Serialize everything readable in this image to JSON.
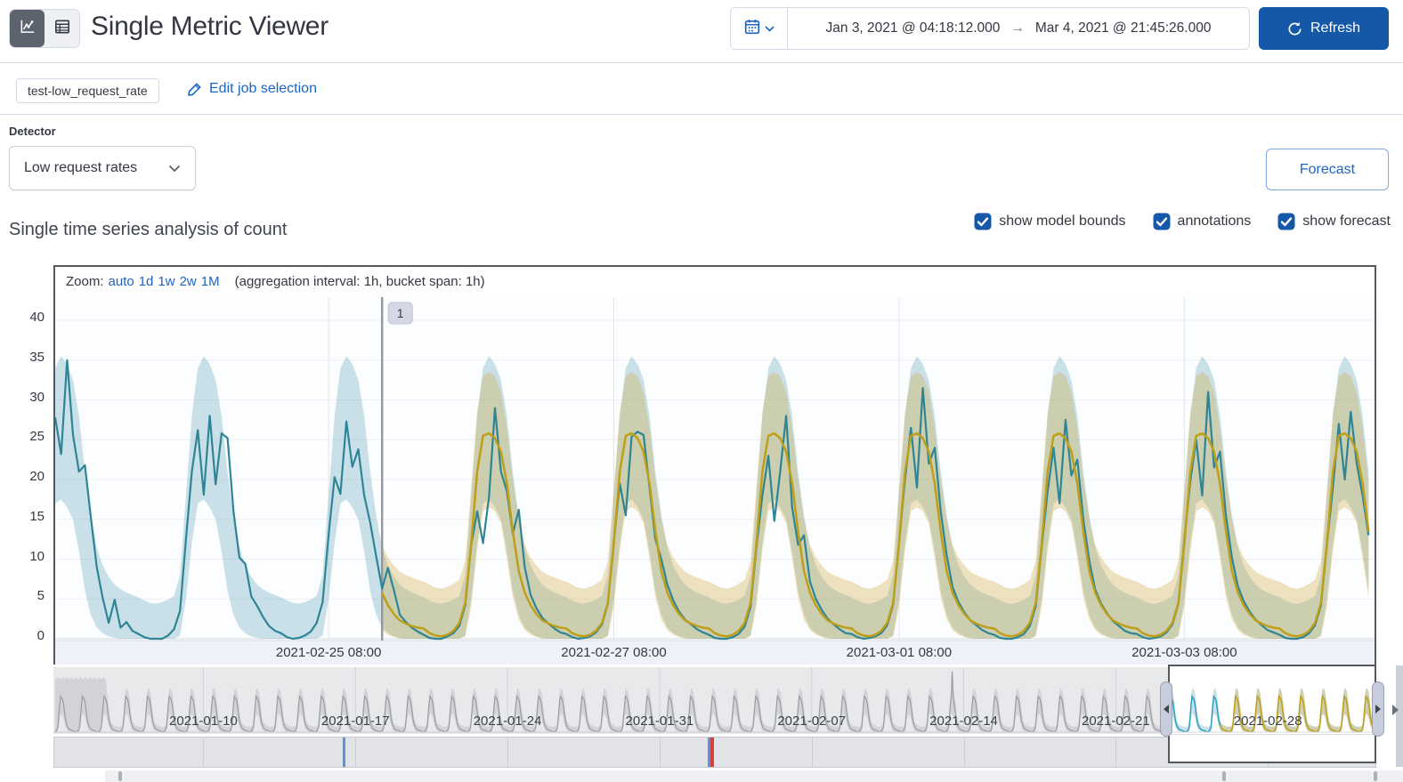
{
  "header": {
    "title": "Single Metric Viewer",
    "refresh_label": "Refresh",
    "time_range": {
      "start": "Jan 3, 2021 @ 04:18:12.000",
      "arrow": "→",
      "end": "Mar 4, 2021 @ 21:45:26.000"
    }
  },
  "job_bar": {
    "job_badge": "test-low_request_rate",
    "edit_link": "Edit job selection"
  },
  "detector": {
    "label": "Detector",
    "selected": "Low request rates"
  },
  "forecast_button_label": "Forecast",
  "analysis": {
    "heading": "Single time series analysis of count",
    "checkboxes": [
      {
        "label": "show model bounds",
        "checked": true
      },
      {
        "label": "annotations",
        "checked": true
      },
      {
        "label": "show forecast",
        "checked": true
      }
    ]
  },
  "zoom_bar": {
    "prefix": "Zoom:",
    "links": [
      "auto",
      "1d",
      "1w",
      "2w",
      "1M"
    ],
    "suffix": "(aggregation interval: 1h, bucket span: 1h)"
  },
  "colors": {
    "primary_button": "#1658a8",
    "link": "#1c64c2",
    "text": "#343741",
    "actual_line": "#2e8596",
    "forecast_line": "#bf9e18",
    "model_bounds_fill": "rgba(62,146,173,0.27)",
    "forecast_bounds_fill": "rgba(208,170,64,0.33)",
    "mini_actual_line": "#2ba0c0",
    "context_line": "#9a9ca1",
    "context_band": "#d2d3d7",
    "context_bg": "#e8e9eb",
    "axis_band": "#eff3f9",
    "annotation_marker_blue": "#5a96dc",
    "annotation_marker_red": "#d93f3c"
  },
  "chart_data": {
    "type": "line",
    "title": "Single time series analysis of count",
    "main": {
      "ylim": [
        0,
        42.9
      ],
      "yticks": [
        0,
        5,
        10,
        15,
        20,
        25,
        30,
        35,
        40
      ],
      "start_hour_of_day": 10,
      "xticks": [
        {
          "t": 46,
          "label": "2021-02-25 08:00"
        },
        {
          "t": 94,
          "label": "2021-02-27 08:00"
        },
        {
          "t": 142,
          "label": "2021-03-01 08:00"
        },
        {
          "t": 190,
          "label": "2021-03-03 08:00"
        }
      ],
      "annotation": {
        "t": 55,
        "label": "1"
      },
      "actual": [
        27.8,
        23.2,
        35,
        25.6,
        21,
        21.8,
        15.2,
        9,
        5.1,
        2,
        4.9,
        1.4,
        2.1,
        1,
        0.6,
        0.2,
        0,
        0,
        0,
        0.4,
        1.2,
        3.5,
        12.5,
        21,
        26.2,
        18.1,
        28,
        19.4,
        25.8,
        25.2,
        16,
        10.2,
        9.4,
        5.3,
        4.1,
        2.7,
        1.6,
        1,
        0.7,
        0.2,
        0,
        0.1,
        0.4,
        0.9,
        2,
        4.6,
        13,
        20.3,
        18.2,
        27.3,
        21.6,
        23.8,
        18,
        14.6,
        10.4,
        6.3,
        8.9,
        6.1,
        3,
        2.1,
        1.4,
        0.9,
        0.5,
        0.1,
        0,
        0,
        0.3,
        0.7,
        1.6,
        4.2,
        11.8,
        16,
        12,
        17.8,
        29,
        21,
        18.5,
        13.2,
        16.2,
        9,
        5.5,
        3.8,
        2.6,
        1.9,
        1.3,
        0.8,
        0.6,
        0.2,
        0,
        0.1,
        0.3,
        0.8,
        1.8,
        4.4,
        12.2,
        19.5,
        15.5,
        25.4,
        26,
        25.6,
        19,
        12.5,
        10,
        6.8,
        4.8,
        3.4,
        2.4,
        1.8,
        1.2,
        0.8,
        0.5,
        0.1,
        0,
        0,
        0.2,
        0.6,
        1.5,
        4,
        11.5,
        18,
        23,
        14.8,
        21,
        28,
        16.5,
        11.8,
        13,
        7.2,
        5,
        3.6,
        2.5,
        1.8,
        1.2,
        0.7,
        0.6,
        0.2,
        0,
        0.1,
        0.3,
        0.7,
        1.7,
        4.3,
        12,
        20,
        26.5,
        19,
        31.5,
        22,
        24,
        16,
        10.5,
        6.5,
        4.6,
        3.3,
        2.3,
        1.7,
        1.1,
        0.7,
        0.5,
        0.1,
        0,
        0,
        0.2,
        0.6,
        1.6,
        4.1,
        11.6,
        18.5,
        24,
        17,
        27.5,
        20.5,
        22.5,
        15,
        9.8,
        6.2,
        4.4,
        3.2,
        2.2,
        1.6,
        1,
        0.7,
        0.6,
        0.2,
        0,
        0.1,
        0.3,
        0.8,
        1.8,
        4.4,
        12.4,
        19.8,
        25,
        18,
        31,
        21.5,
        23.5,
        15.5,
        10.2,
        6.6,
        4.7,
        3.4,
        2.4,
        1.7,
        1.1,
        0.8,
        0.5,
        0.1,
        0,
        0,
        0.2,
        0.7,
        1.7,
        4.2,
        11.9,
        19,
        27,
        20,
        28.5,
        22,
        18,
        13
      ],
      "model_bounds": {
        "lo": [
          0,
          0,
          0,
          0,
          0,
          0,
          0,
          0.4,
          5,
          12,
          17,
          17.5,
          16.5,
          15,
          11,
          6,
          3,
          1.4,
          0.7,
          0.3,
          0.1,
          0,
          0,
          0
        ],
        "hi": [
          5.2,
          4.8,
          4.5,
          4.4,
          4.6,
          4.9,
          5.4,
          8,
          18,
          28,
          34,
          35.5,
          34.5,
          32.5,
          28,
          21,
          15.5,
          11.5,
          9.2,
          7.8,
          6.8,
          6.2,
          5.8,
          5.5
        ]
      },
      "forecast": {
        "t_start": 55,
        "values": [
          1.3,
          0.7,
          0.4,
          0.3,
          0.5,
          1,
          2,
          4.5,
          12,
          21,
          25.5,
          25.8,
          25.2,
          23.5,
          19.5,
          13.5,
          8.5,
          5.8,
          4.2,
          3.1,
          2.3,
          1.9,
          1.6,
          1.4
        ]
      },
      "forecast_bounds": {
        "t_start": 55,
        "lo": [
          0,
          0,
          0,
          0,
          0,
          0,
          0,
          0.3,
          4,
          11,
          16,
          16.5,
          16,
          14.5,
          10,
          5.2,
          2.4,
          1.1,
          0.5,
          0.2,
          0,
          0,
          0,
          0
        ],
        "hi": [
          7.2,
          6.8,
          6.4,
          6.3,
          6.5,
          6.9,
          7.4,
          9.8,
          19,
          28.5,
          33,
          33.5,
          33,
          31,
          26.5,
          20,
          15,
          11.8,
          10.2,
          9.2,
          8.4,
          8,
          7.7,
          7.4
        ]
      }
    },
    "context": {
      "days_total": 60.73,
      "start_hour_of_day": 4,
      "xticks": [
        {
          "day": 6.82,
          "label": "2021-01-10"
        },
        {
          "day": 13.82,
          "label": "2021-01-17"
        },
        {
          "day": 20.82,
          "label": "2021-01-24"
        },
        {
          "day": 27.82,
          "label": "2021-01-31"
        },
        {
          "day": 34.82,
          "label": "2021-02-07"
        },
        {
          "day": 41.82,
          "label": "2021-02-14"
        },
        {
          "day": 48.82,
          "label": "2021-02-28"
        },
        {
          "day": 55.82,
          "label": "2021-02-28"
        }
      ],
      "xtick_labels": [
        "2021-01-10",
        "2021-01-17",
        "2021-01-24",
        "2021-01-31",
        "2021-02-07",
        "2021-02-14",
        "2021-02-21",
        "2021-02-28"
      ],
      "line_template": [
        1,
        0.5,
        0.3,
        0.3,
        0.5,
        1,
        2,
        4,
        12,
        20,
        26,
        25,
        24,
        21,
        16,
        11,
        7,
        5,
        3.5,
        2.5,
        2,
        1.7,
        1.4,
        1.2
      ],
      "band_lo_template": [
        0,
        0,
        0,
        0,
        0,
        0,
        0,
        1,
        5,
        10,
        13,
        13,
        12,
        11,
        8,
        5,
        3,
        1.5,
        1,
        0.5,
        0.3,
        0.2,
        0.1,
        0
      ],
      "band_hi_template": [
        4,
        4,
        4,
        4,
        4,
        4.5,
        5,
        8,
        17,
        26,
        31,
        32,
        31,
        29,
        25,
        19,
        13,
        9,
        7,
        6,
        5.5,
        5,
        4.6,
        4.3
      ],
      "init_wide_until_day": 2.35,
      "init_wide_value": 39,
      "spike": {
        "day": 41.3,
        "value": 44
      },
      "selection": {
        "from_day": 51.24,
        "to_day": 60.73,
        "forecast_from_day": 53.53
      },
      "annotation_markers": [
        {
          "day": 13.25,
          "color": "blue"
        },
        {
          "day": 30.02,
          "color": "blue"
        },
        {
          "day": 30.18,
          "color": "red"
        }
      ]
    }
  }
}
